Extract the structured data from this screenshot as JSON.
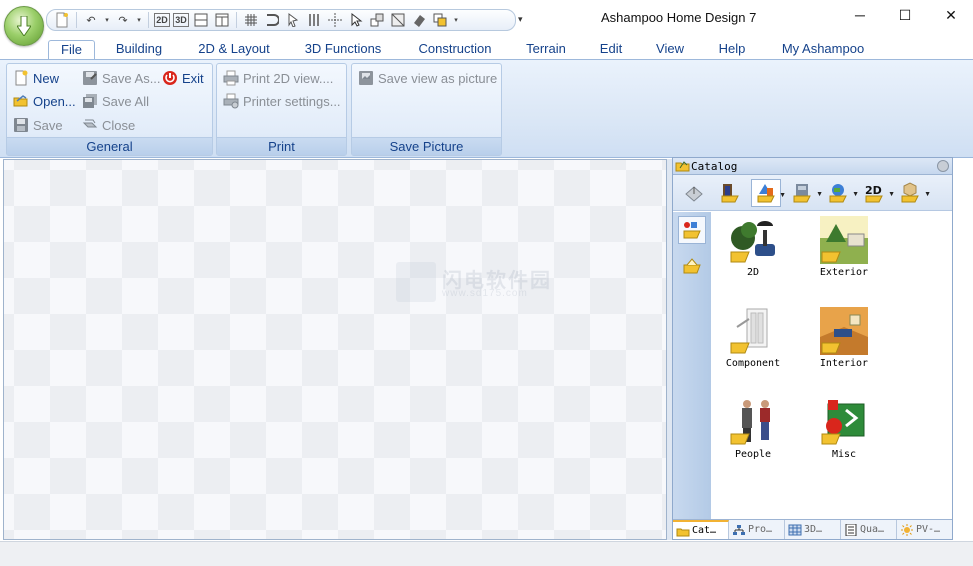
{
  "window": {
    "title": "Ashampoo Home Design 7",
    "controls": [
      "─",
      "☐",
      "✕"
    ]
  },
  "ribbon": {
    "tabs": [
      "File",
      "Building",
      "2D & Layout",
      "3D Functions",
      "Construction",
      "Terrain",
      "Edit",
      "View",
      "Help",
      "My Ashampoo"
    ],
    "active_tab": "File",
    "groups": {
      "general": {
        "label": "General",
        "new": "New",
        "open": "Open...",
        "save": "Save",
        "save_as": "Save As...",
        "save_all": "Save All",
        "close": "Close",
        "exit": "Exit"
      },
      "print": {
        "label": "Print",
        "print_2d": "Print 2D view....",
        "printer_settings": "Printer settings..."
      },
      "save_picture": {
        "label": "Save Picture",
        "save_view": "Save view as picture"
      }
    }
  },
  "catalog": {
    "title": "Catalog",
    "items": [
      {
        "label": "2D"
      },
      {
        "label": "Exterior"
      },
      {
        "label": "Component"
      },
      {
        "label": "Interior"
      },
      {
        "label": "People"
      },
      {
        "label": "Misc"
      }
    ],
    "bottom_tabs": [
      "Cat…",
      "Pro…",
      "3D…",
      "Qua…",
      "PV-…"
    ]
  },
  "watermark": {
    "line1": "闪电软件园",
    "line2": "www.sd175.com"
  },
  "colors": {
    "ribbon_text": "#15428b",
    "disabled_text": "#8a8f96",
    "accent_orange": "#f2b233"
  }
}
